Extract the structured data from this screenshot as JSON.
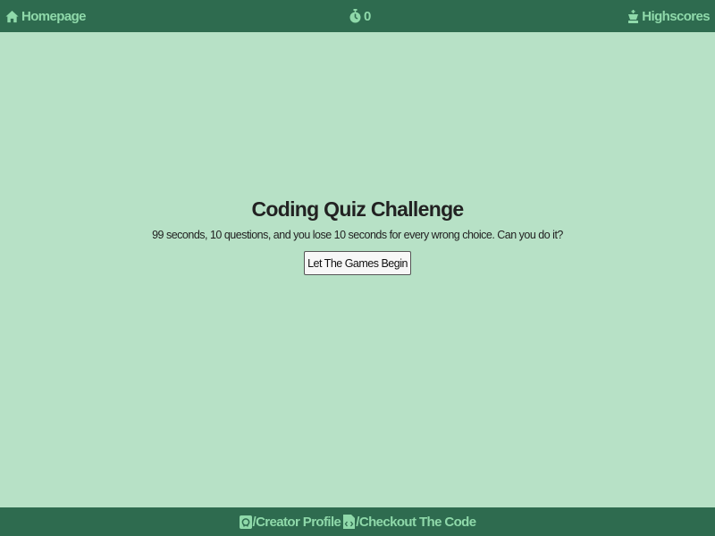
{
  "header": {
    "home_label": "Homepage",
    "home_icon": "home-icon",
    "timer_value": "0",
    "timer_icon": "stopwatch-icon",
    "highscores_label": "Highscores",
    "highscores_icon": "chess-king-icon"
  },
  "main": {
    "title": "Coding Quiz Challenge",
    "description": "99 seconds, 10 questions, and you lose 10 seconds for every wrong choice. Can you do it?",
    "start_button_label": "Let The Games Begin"
  },
  "footer": {
    "creator_label": "/Creator Profile",
    "creator_icon": "github-icon",
    "code_label": "/Checkout The Code",
    "code_icon": "code-file-icon"
  },
  "colors": {
    "bar_background": "#2e6b4f",
    "bar_text": "#8fd9aa",
    "page_background": "#b7e1c6"
  }
}
